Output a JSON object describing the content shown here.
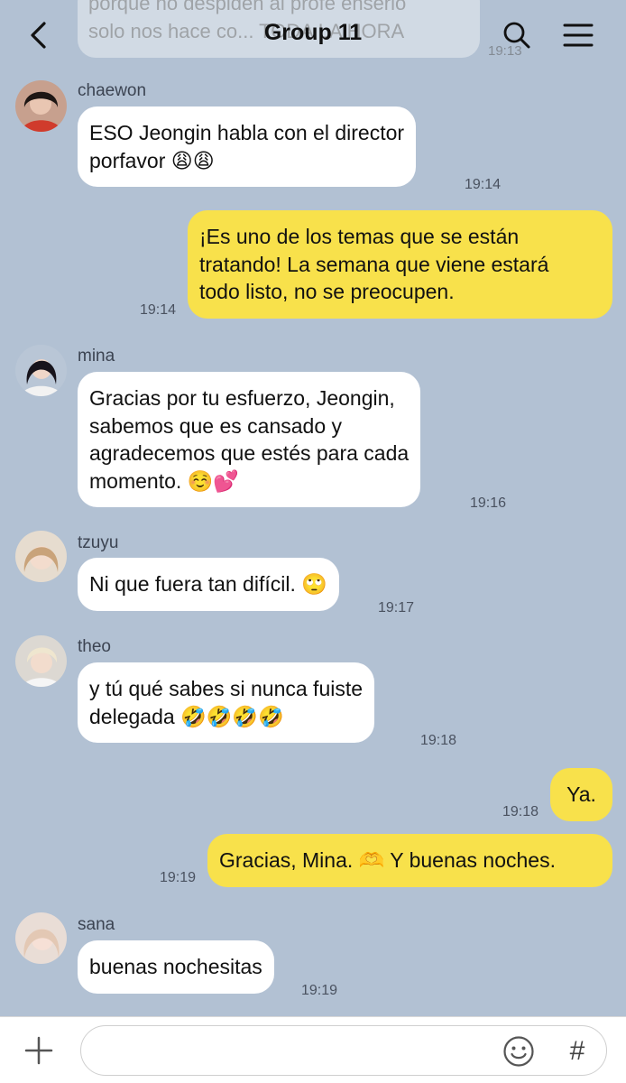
{
  "header": {
    "title": "Group 11",
    "back_icon": "chevron-left-icon",
    "search_icon": "search-icon",
    "menu_icon": "hamburger-menu-icon"
  },
  "previous_message": {
    "line1": "porque no despiden al profe enserio",
    "line2": "solo nos hace co... TODA LA HORA",
    "time": "19:13"
  },
  "messages": [
    {
      "sender": "chaewon",
      "lines": [
        "ESO Jeongin habla con el director",
        "porfavor 😩😩"
      ],
      "time": "19:14"
    },
    {
      "sender": "me",
      "lines": [
        "¡Es uno de los temas que se están",
        "tratando! La semana que viene estará",
        "todo listo, no se preocupen."
      ],
      "time": "19:14"
    },
    {
      "sender": "mina",
      "lines": [
        "Gracias por tu esfuerzo, Jeongin,",
        "sabemos que es cansado y",
        "agradecemos que estés para cada",
        "momento. ☺️💕"
      ],
      "time": "19:16"
    },
    {
      "sender": "tzuyu",
      "lines": [
        "Ni que fuera tan difícil. 🙄"
      ],
      "time": "19:17"
    },
    {
      "sender": "theo",
      "lines": [
        "y tú qué sabes si nunca fuiste",
        "delegada 🤣🤣🤣🤣"
      ],
      "time": "19:18"
    },
    {
      "sender": "me",
      "lines": [
        "Ya."
      ],
      "time": "19:18"
    },
    {
      "sender": "me",
      "lines": [
        "Gracias, Mina. 🫶 Y buenas noches."
      ],
      "time": "19:19"
    },
    {
      "sender": "sana",
      "lines": [
        "buenas nochesitas"
      ],
      "time": "19:19"
    }
  ],
  "input": {
    "placeholder": "",
    "plus_icon": "plus-icon",
    "emoji_icon": "emoji-icon",
    "hash_label": "#"
  },
  "colors": {
    "background": "#b2c1d3",
    "incoming_bubble": "#ffffff",
    "outgoing_bubble": "#f8e14b"
  }
}
